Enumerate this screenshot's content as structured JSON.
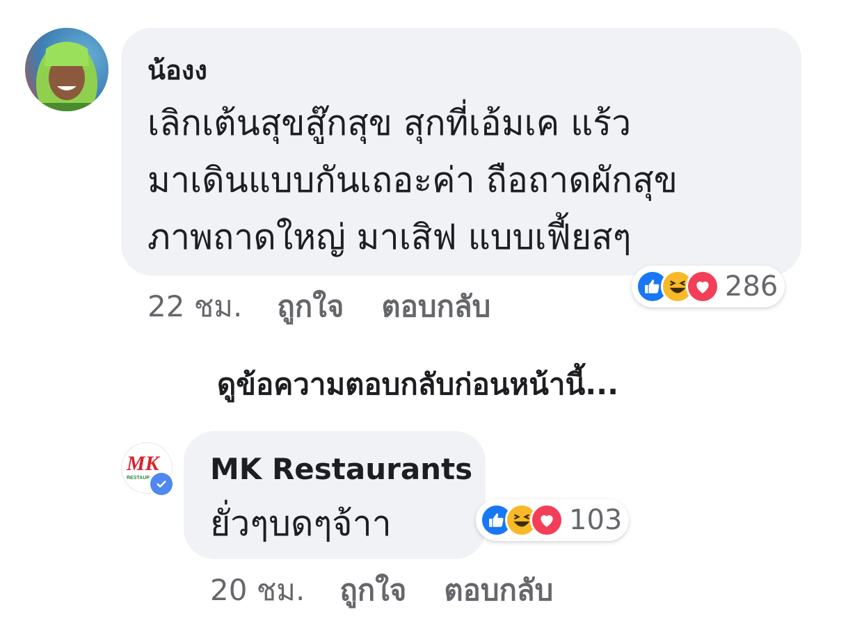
{
  "comment1": {
    "author": "น้องง",
    "text": "เลิกเต้นสุขสู๊กสุข  สุกที่เอ้มเค แร้ว\nมาเดินแบบกันเถอะค่า ถือถาดผักสุข\nภาพถาดใหญ่ มาเสิฟ แบบเฟี้ยสๆ",
    "time": "22 ชม.",
    "like_label": "ถูกใจ",
    "reply_label": "ตอบกลับ",
    "reaction_count": "286",
    "reactions": [
      "like-icon",
      "haha-icon",
      "love-icon"
    ]
  },
  "view_previous_label": "ดูข้อความตอบกลับก่อนหน้านี้...",
  "comment2": {
    "author": "MK Restaurants",
    "avatar_text": "MK",
    "avatar_subtext": "RESTAURANTS",
    "text": "ยั่วๆบดๆจ้าา",
    "time": "20 ชม.",
    "like_label": "ถูกใจ",
    "reply_label": "ตอบกลับ",
    "reaction_count": "103",
    "reactions": [
      "like-icon",
      "haha-icon",
      "love-icon"
    ],
    "verified": true
  },
  "colors": {
    "bubble": "#f0f2f5",
    "meta_text": "#65676b",
    "like": "#1877f2",
    "haha": "#f7b928",
    "love": "#f33e58",
    "verified": "#4e88f0"
  }
}
